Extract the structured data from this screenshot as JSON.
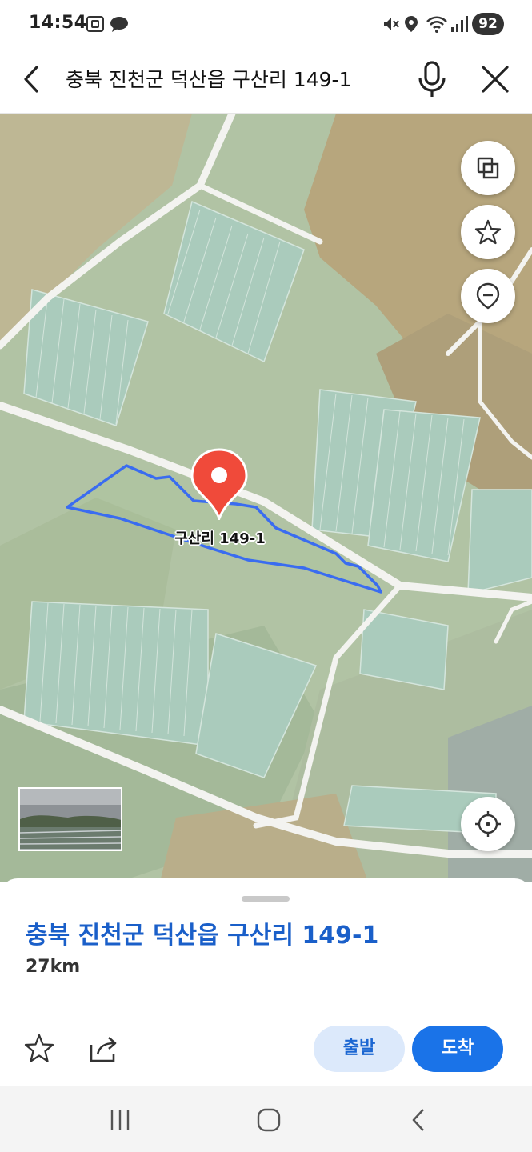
{
  "status_bar": {
    "time": "14:54",
    "battery": "92",
    "left_icons": [
      "screenshot-icon",
      "chat-bubble-icon"
    ],
    "right_icons": [
      "mute-icon",
      "location-icon",
      "wifi-icon",
      "signal-icon"
    ]
  },
  "search": {
    "query": "충북 진천군 덕산읍 구산리 149-1"
  },
  "map": {
    "place_label": "구산리 149-1",
    "controls": [
      "layers-icon",
      "star-icon",
      "location-pin-icon",
      "my-location-icon"
    ],
    "accent_color": "#f04a3a",
    "boundary_color": "#3a6cf0"
  },
  "sheet": {
    "title": "충북 진천군 덕산읍 구산리 149-1",
    "distance": "27km",
    "depart_label": "출발",
    "arrive_label": "도착"
  },
  "nav": {
    "icons": [
      "recent-apps-icon",
      "home-icon",
      "back-icon"
    ]
  }
}
